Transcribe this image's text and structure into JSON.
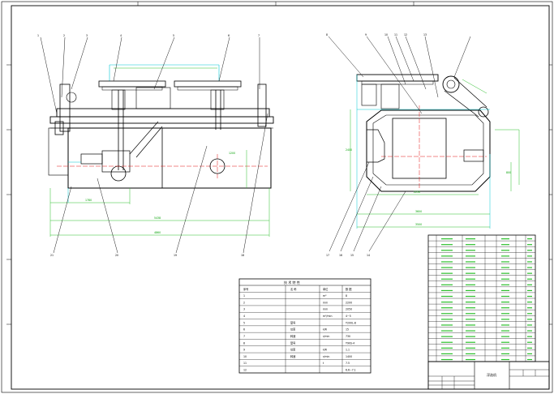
{
  "drawing": {
    "title_block_text": "浮选机",
    "side_labels": [
      "1",
      "2",
      "3",
      "4",
      "5",
      "6",
      "7"
    ],
    "balloons_left_top": [
      "1",
      "2",
      "3",
      "4",
      "5",
      "6",
      "7"
    ],
    "balloons_left_bottom": [
      "21",
      "20",
      "19",
      "18"
    ],
    "balloons_right_top": [
      "8",
      "9",
      "10",
      "11",
      "12",
      "13"
    ],
    "balloons_right_bottom": [
      "17",
      "16",
      "15",
      "14"
    ],
    "dims_left": [
      "1780",
      "5438",
      "4860",
      "1200"
    ],
    "dims_right": [
      "2250",
      "3600",
      "3500",
      "800",
      "2400"
    ],
    "spec_table": {
      "header": [
        "技 术 特 性"
      ],
      "rows": [
        [
          "序号",
          "名 称",
          "单位",
          "数 据"
        ],
        [
          "1",
          "",
          "m³",
          "8"
        ],
        [
          "2",
          "",
          "mm",
          "2200"
        ],
        [
          "3",
          "",
          "mm",
          "2050"
        ],
        [
          "4",
          "",
          "m³/min",
          "4~5"
        ],
        [
          "5",
          "型号",
          "",
          "Y200L-8"
        ],
        [
          "6",
          "功率",
          "kW",
          "15"
        ],
        [
          "7",
          "转速",
          "r/min",
          "730"
        ],
        [
          "8",
          "型号",
          "",
          "Y90S-4"
        ],
        [
          "9",
          "功率",
          "kW",
          "1.1"
        ],
        [
          "10",
          "转速",
          "r/min",
          "1400"
        ],
        [
          "11",
          "",
          "t",
          "7.5"
        ],
        [
          "12",
          "",
          "",
          "6.6~7.1"
        ]
      ]
    },
    "parts_list_rows": 22
  }
}
